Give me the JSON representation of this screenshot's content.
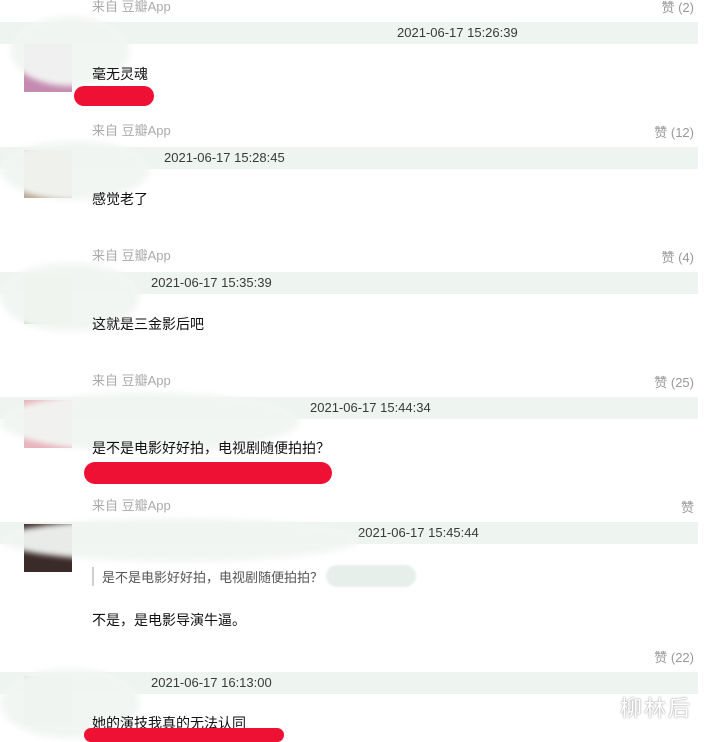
{
  "comments": [
    {
      "timestamp": "2021-06-17 15:26:39",
      "text": "毫无灵魂",
      "source": "来自 豆瓣App",
      "likes": "赞 (12)"
    },
    {
      "timestamp": "2021-06-17 15:28:45",
      "text": "感觉老了",
      "source": "来自 豆瓣App",
      "likes": "赞 (4)"
    },
    {
      "timestamp": "2021-06-17 15:35:39",
      "text": "这就是三金影后吧",
      "source": "来自 豆瓣App",
      "likes": "赞 (25)"
    },
    {
      "timestamp": "2021-06-17 15:44:34",
      "text": "是不是电影好好拍，电视剧随便拍拍？",
      "source": "来自 豆瓣App",
      "likes": "赞"
    },
    {
      "timestamp": "2021-06-17 15:45:44",
      "quote": "是不是电影好好拍，电视剧随便拍拍？",
      "text": "不是，是电影导演牛逼。",
      "likes": "赞 (22)"
    },
    {
      "timestamp": "2021-06-17 16:13:00",
      "text": "她的演技我真的无法认同"
    }
  ],
  "top_partial": {
    "source": "来自 豆瓣App",
    "likes": "赞 (2)"
  },
  "watermark": "柳林后",
  "colors": {
    "meta_bar": "#eef4f0",
    "redaction": "#ee1133",
    "timestamp_text": "#3a3a3a",
    "source_text": "#aaaaaa"
  }
}
